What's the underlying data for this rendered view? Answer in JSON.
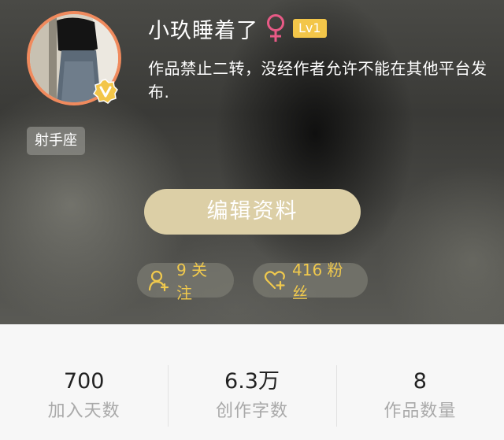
{
  "profile": {
    "username": "小玖睡着了",
    "gender_icon": "female-symbol-icon",
    "level": "Lv1",
    "bio": "作品禁止二转，没经作者允许不能在其他平台发布.",
    "zodiac": "射手座",
    "verified_badge_icon": "v-badge-icon"
  },
  "actions": {
    "edit_profile_label": "编辑资料"
  },
  "social": {
    "following": "9 关注",
    "fans": "416 粉丝"
  },
  "stats": [
    {
      "value": "700",
      "label": "加入天数"
    },
    {
      "value": "6.3万",
      "label": "创作字数"
    },
    {
      "value": "8",
      "label": "作品数量"
    }
  ],
  "colors": {
    "accent_gold": "#f0c94d",
    "level_badge": "#f3c649",
    "avatar_ring": "#f08a5d",
    "edit_button": "#dccfa6"
  }
}
